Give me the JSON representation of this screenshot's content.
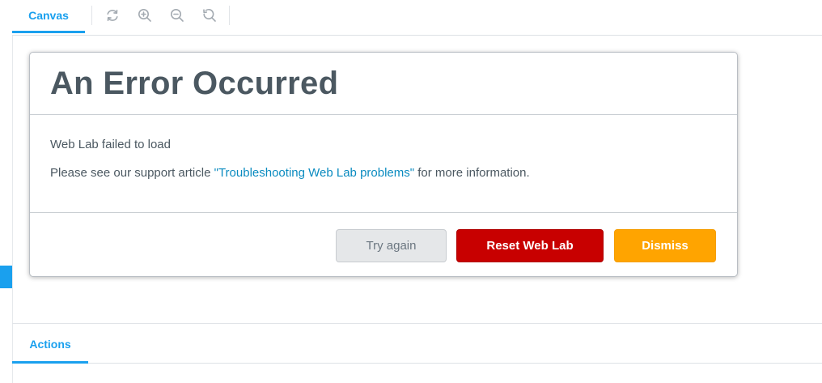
{
  "toolbar": {
    "tab_label": "Canvas",
    "icons": [
      "refresh-icon",
      "zoom-in-icon",
      "zoom-out-icon",
      "reset-zoom-icon"
    ]
  },
  "modal": {
    "title": "An Error Occurred",
    "message": "Web Lab failed to load",
    "support_prefix": "Please see our support article ",
    "support_link": "\"Troubleshooting Web Lab problems\"",
    "support_suffix": " for more information.",
    "buttons": {
      "try_again": "Try again",
      "reset": "Reset Web Lab",
      "dismiss": "Dismiss"
    }
  },
  "actions": {
    "tab_label": "Actions"
  },
  "colors": {
    "accent": "#1aa0ee",
    "reset_button": "#c80000",
    "dismiss_button": "#ffa400",
    "title_text": "#4b5861",
    "link": "#0a8bc0"
  }
}
